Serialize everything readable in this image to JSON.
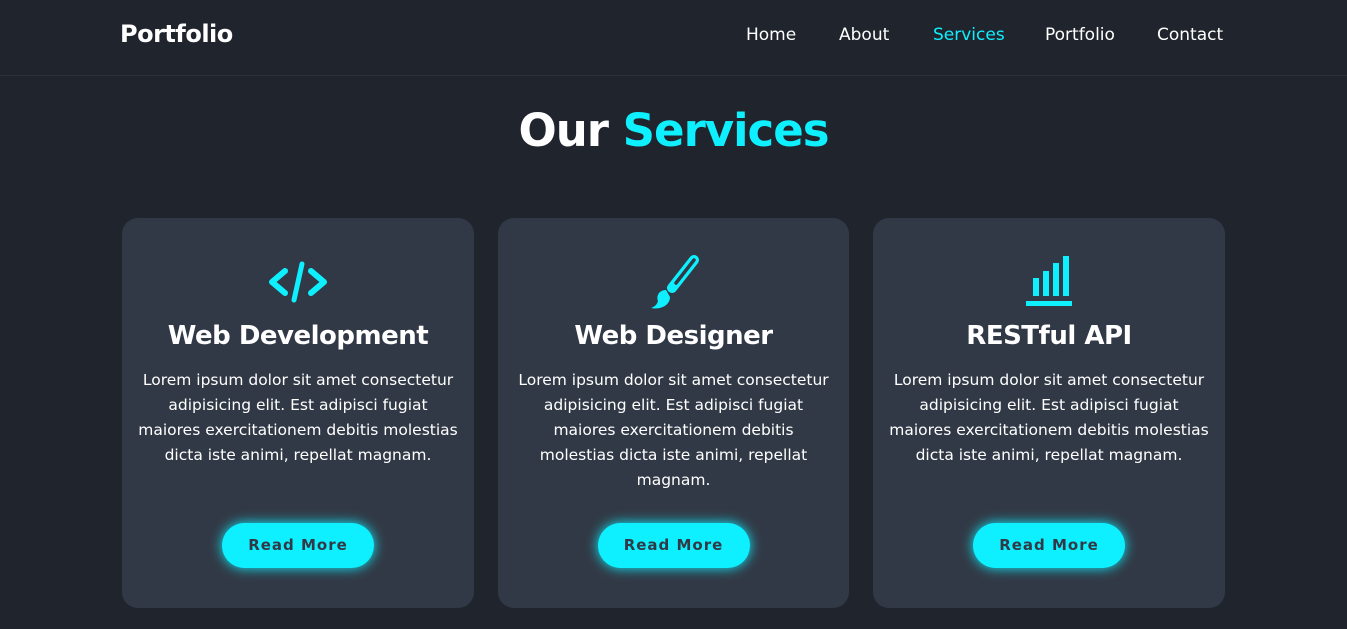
{
  "header": {
    "logo": "Portfolio",
    "nav": [
      {
        "label": "Home",
        "active": false
      },
      {
        "label": "About",
        "active": false
      },
      {
        "label": "Services",
        "active": true
      },
      {
        "label": "Portfolio",
        "active": false
      },
      {
        "label": "Contact",
        "active": false
      }
    ]
  },
  "section": {
    "title_main": "Our ",
    "title_accent": "Services"
  },
  "services": [
    {
      "icon": "code-icon",
      "title": "Web Development",
      "description": "Lorem ipsum dolor sit amet consectetur adipisicing elit. Est adipisci fugiat maiores exercitationem debitis molestias dicta iste animi, repellat magnam.",
      "button": "Read More"
    },
    {
      "icon": "paint-brush-icon",
      "title": "Web Designer",
      "description": "Lorem ipsum dolor sit amet consectetur adipisicing elit. Est adipisci fugiat maiores exercitationem debitis molestias dicta iste animi, repellat magnam.",
      "button": "Read More"
    },
    {
      "icon": "bar-chart-icon",
      "title": "RESTful API",
      "description": "Lorem ipsum dolor sit amet consectetur adipisicing elit. Est adipisci fugiat maiores exercitationem debitis molestias dicta iste animi, repellat magnam.",
      "button": "Read More"
    }
  ],
  "colors": {
    "background": "#1f242d",
    "card": "#323946",
    "accent": "#0ef0ff",
    "text": "#ffffff"
  }
}
